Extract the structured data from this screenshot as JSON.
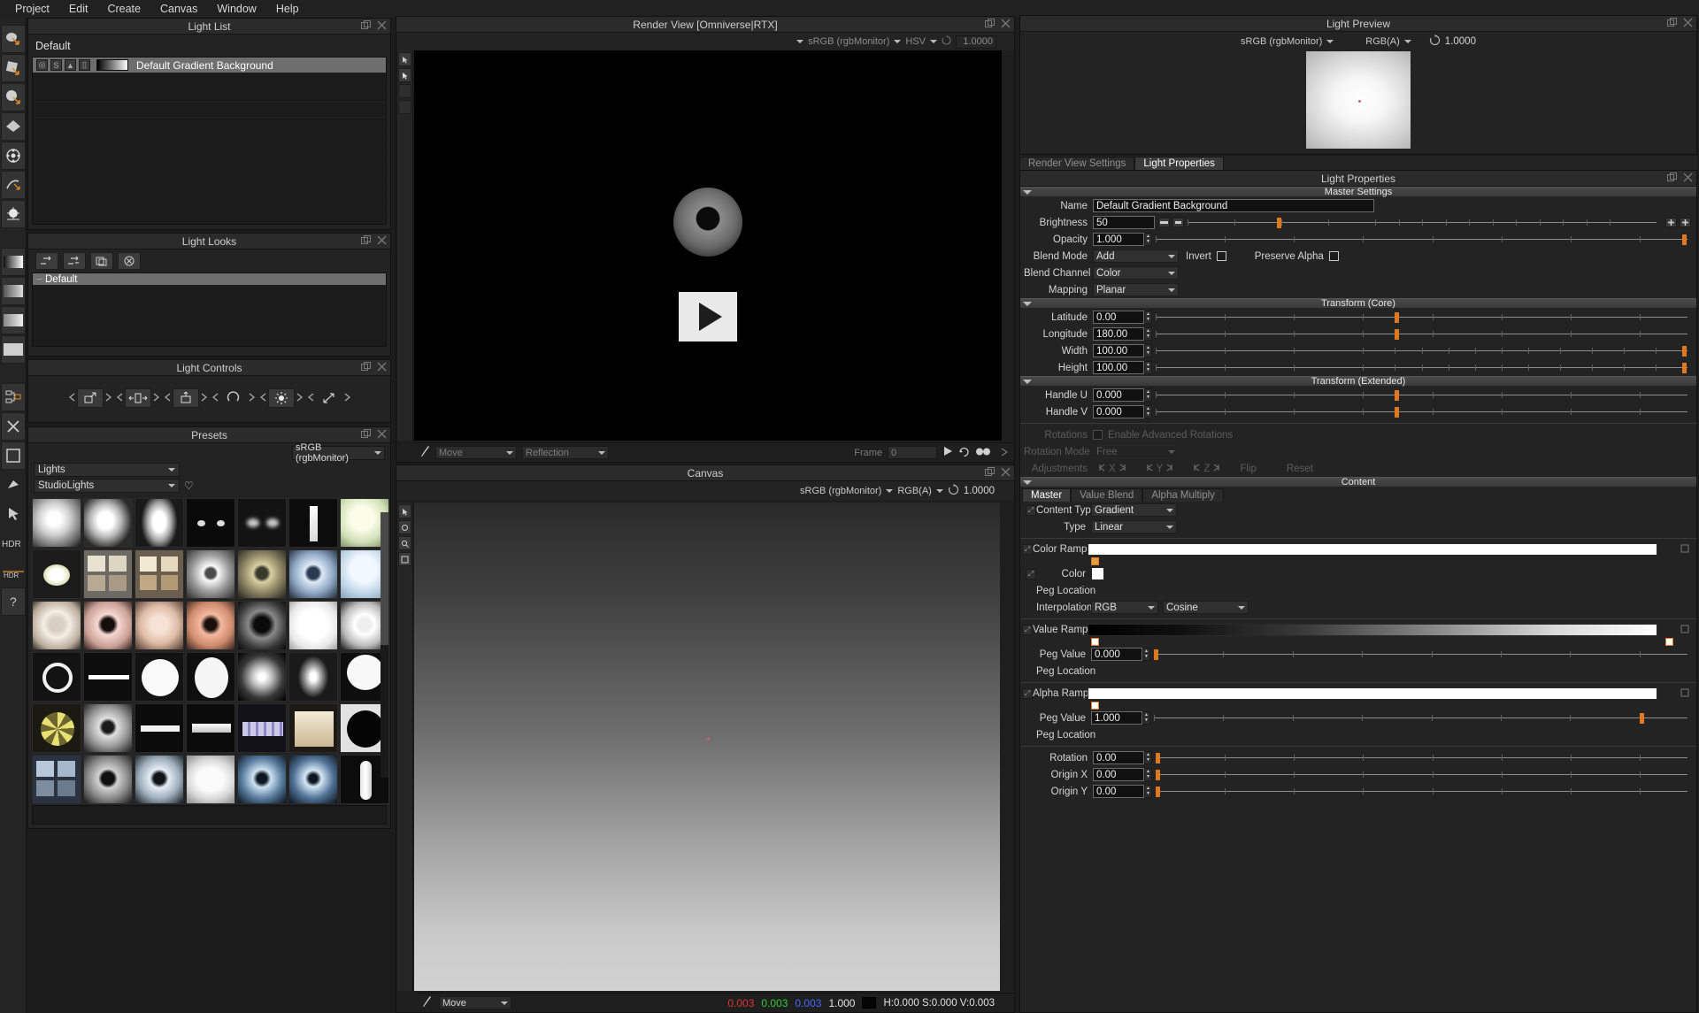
{
  "menubar": {
    "items": [
      "Project",
      "Edit",
      "Create",
      "Canvas",
      "Window",
      "Help"
    ]
  },
  "light_list": {
    "title": "Light List",
    "group_label": "Default",
    "row": {
      "name": "Default Gradient Background",
      "toggles": [
        "O",
        "S",
        "▸",
        "■"
      ]
    }
  },
  "light_looks": {
    "title": "Light Looks",
    "toolbar_icons": [
      "add-look-icon",
      "duplicate-look-icon",
      "copy-look-icon",
      "delete-look-icon"
    ],
    "items": [
      "Default"
    ]
  },
  "light_controls": {
    "title": "Light Controls",
    "buttons": [
      "translate-icon",
      "scale-icon",
      "pivot-icon",
      "rotate-icon",
      "brightness-icon",
      "stretch-icon"
    ]
  },
  "presets": {
    "title": "Presets",
    "colorspace": "sRGB (rgbMonitor)",
    "category": "Lights",
    "subcategory": "StudioLights",
    "favorite_icon": "heart-icon",
    "thumbnails": [
      [
        "sphere-gray",
        "soft-sphere",
        "oval-sphere",
        "dark-eye",
        "dark-soft",
        "vertical-strip",
        "green-sphere"
      ],
      [
        "bright-oval",
        "window-panes",
        "window-warm",
        "ring-sphere",
        "ring-olive",
        "blue-ring",
        "blue-sphere"
      ],
      [
        "ring-beige",
        "ring-pink",
        "ring-peach",
        "ring-salmon",
        "dark-ring",
        "white-blob",
        "white-ring"
      ],
      [
        "thin-ring",
        "bar-white",
        "white-disc",
        "white-oval",
        "soft-glow",
        "soft-glow2",
        "half-disc"
      ],
      [
        "yellow-star",
        "gray-ring",
        "bar-dark",
        "bar-strip",
        "purple-grid",
        "warm-square",
        "black-disc"
      ],
      [
        "window-blue",
        "ring-dark",
        "ring-blue",
        "soft-white",
        "blue-glow",
        "blue-glow2",
        "capsule"
      ]
    ]
  },
  "render_view": {
    "title": "Render View [Omniverse|RTX]",
    "colorspace": "sRGB (rgbMonitor)",
    "mode": "HSV",
    "exposure": "1.0000",
    "footer": {
      "tool": "Move",
      "shading": "Reflection",
      "frame_label": "Frame",
      "frame_value": "0",
      "play_icon": "play-icon",
      "loop_icon": "loop-icon",
      "stereo_icon": "stereo-icon"
    }
  },
  "canvas": {
    "title": "Canvas",
    "colorspace": "sRGB (rgbMonitor)",
    "channel": "RGB(A)",
    "exposure": "1.0000",
    "footer": {
      "tool": "Move",
      "r": "0.003",
      "g": "0.003",
      "b": "0.003",
      "a": "1.000",
      "hsv": "H:0.000 S:0.000 V:0.003"
    }
  },
  "light_preview": {
    "title": "Light Preview",
    "colorspace": "sRGB (rgbMonitor)",
    "channel": "RGB(A)",
    "exposure": "1.0000"
  },
  "tabs": [
    {
      "label": "Render View Settings",
      "active": false
    },
    {
      "label": "Light Properties",
      "active": true
    }
  ],
  "light_properties": {
    "title": "Light Properties",
    "master_settings": {
      "header": "Master Settings",
      "name_label": "Name",
      "name_value": "Default Gradient Background",
      "brightness_label": "Brightness",
      "brightness_value": "50",
      "brightness_knob_pct": 19,
      "opacity_label": "Opacity",
      "opacity_value": "1.000",
      "blend_mode_label": "Blend Mode",
      "blend_mode_value": "Add",
      "invert_label": "Invert",
      "preserve_alpha_label": "Preserve Alpha",
      "blend_channel_label": "Blend Channel",
      "blend_channel_value": "Color",
      "mapping_label": "Mapping",
      "mapping_value": "Planar"
    },
    "transform_core": {
      "header": "Transform (Core)",
      "rows": [
        {
          "label": "Latitude",
          "value": "0.00",
          "knob_pct": 45
        },
        {
          "label": "Longitude",
          "value": "180.00",
          "knob_pct": 45
        },
        {
          "label": "Width",
          "value": "100.00",
          "knob_pct": 99
        },
        {
          "label": "Height",
          "value": "100.00",
          "knob_pct": 99
        }
      ]
    },
    "transform_extended": {
      "header": "Transform (Extended)",
      "rows": [
        {
          "label": "Handle U",
          "value": "0.000",
          "knob_pct": 45
        },
        {
          "label": "Handle V",
          "value": "0.000",
          "knob_pct": 45
        }
      ],
      "rotations_label": "Rotations",
      "enable_advanced_rotations_label": "Enable Advanced Rotations",
      "rotation_mode_label": "Rotation Mode",
      "rotation_mode_value": "Free",
      "adjustments_label": "Adjustments",
      "axes": [
        "X",
        "Y",
        "Z"
      ],
      "flip_label": "Flip",
      "reset_label": "Reset"
    },
    "content": {
      "header": "Content",
      "tabs": [
        {
          "label": "Master",
          "active": true
        },
        {
          "label": "Value Blend",
          "active": false
        },
        {
          "label": "Alpha Multiply",
          "active": false
        }
      ],
      "content_type_label": "Content Type",
      "content_type_value": "Gradient",
      "type_label": "Type",
      "type_value": "Linear",
      "color_ramp_label": "Color Ramp",
      "color_label": "Color",
      "color_value": "#ffffff",
      "peg_location_label": "Peg Location",
      "interpolation_label": "Interpolation",
      "interpolation_space": "RGB",
      "interpolation_curve": "Cosine",
      "value_ramp_label": "Value Ramp",
      "value_peg_label": "Peg Value",
      "value_peg_value": "0.000",
      "alpha_ramp_label": "Alpha Ramp",
      "alpha_peg_label": "Peg Value",
      "alpha_peg_value": "1.000",
      "rotation_label": "Rotation",
      "rotation_value": "0.00",
      "origin_x_label": "Origin X",
      "origin_x_value": "0.00",
      "origin_y_label": "Origin Y",
      "origin_y_value": "0.00"
    }
  },
  "colors": {
    "accent": "#e07820",
    "panel_bg": "#232323",
    "section_bg": "#3f3f3f",
    "selection": "#6e6e6e"
  }
}
